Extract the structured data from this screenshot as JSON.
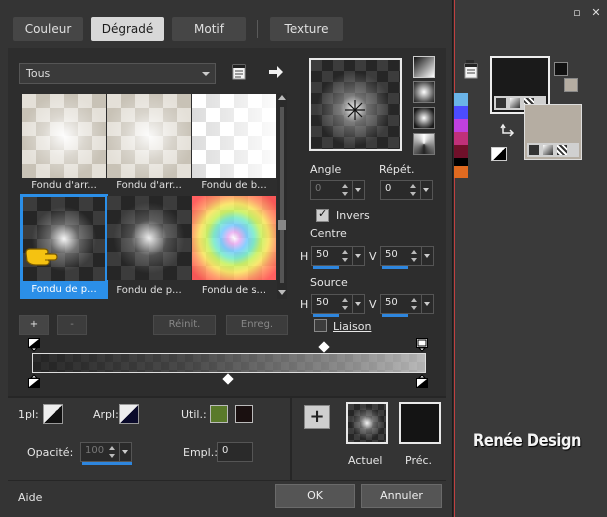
{
  "tabs": [
    {
      "label": "Couleur",
      "active": false
    },
    {
      "label": "Dégradé",
      "active": true
    },
    {
      "label": "Motif",
      "active": false
    },
    {
      "label": "Texture",
      "active": false
    }
  ],
  "category": {
    "selected": "Tous"
  },
  "presets": [
    {
      "label": "Fondu d'arr...",
      "style": "light"
    },
    {
      "label": "Fondu d'arr...",
      "style": "light"
    },
    {
      "label": "Fondu de b...",
      "style": "white"
    },
    {
      "label": "Fondu de p...",
      "style": "dark",
      "selected": true
    },
    {
      "label": "Fondu de p...",
      "style": "dark"
    },
    {
      "label": "Fondu de s...",
      "style": "rainbow"
    }
  ],
  "preset_buttons": {
    "add": "+",
    "remove": "-",
    "reset": "Réinit.",
    "save": "Enreg."
  },
  "params": {
    "angle_label": "Angle",
    "angle_value": "0",
    "repeat_label": "Répét.",
    "repeat_value": "0",
    "invert_label": "Invers",
    "invert_checked": true,
    "center_label": "Centre",
    "center_h_label": "H",
    "center_h": "50",
    "center_v_label": "V",
    "center_v": "50",
    "source_label": "Source",
    "source_h_label": "H",
    "source_h": "50",
    "source_v_label": "V",
    "source_v": "50",
    "link_label": "Liaison",
    "link_checked": false
  },
  "bottom": {
    "opl_label": "1pl:",
    "arpl_label": "Arpl:",
    "util_label": "Util.:",
    "util_color": "#5a7a2a",
    "util_color2": "#1a1010",
    "opacity_label": "Opacité:",
    "opacity_value": "100",
    "empl_label": "Empl.:",
    "empl_value": "0",
    "add_symbol": "+",
    "current_label": "Actuel",
    "previous_label": "Préc."
  },
  "footer": {
    "help": "Aide",
    "ok": "OK",
    "cancel": "Annuler"
  },
  "watermark": "Renée Design",
  "palette_colors": [
    "#6ab4e8",
    "#4c4cff",
    "#c040e0",
    "#c0307a",
    "#70102a",
    "#000000",
    "#e06a20"
  ],
  "window_controls": {
    "restore": "▫",
    "close": "✕"
  }
}
